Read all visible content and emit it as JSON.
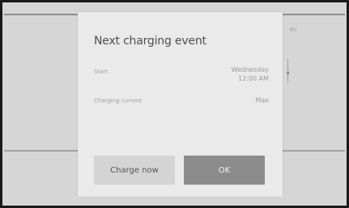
{
  "background": {
    "hint": "Fri"
  },
  "dialog": {
    "title": "Next charging event",
    "rows": [
      {
        "label": "Start",
        "value_line1": "Wednesday",
        "value_line2": "12:00 AM"
      },
      {
        "label": "Charging current",
        "value_line1": "Max"
      }
    ],
    "buttons": {
      "charge_now": "Charge now",
      "ok": "OK"
    }
  },
  "colors": {
    "dialog_bg": "#eaeaea",
    "screen_bg": "#d6d6d6",
    "ok_button": "#8c8c8c",
    "charge_button": "#d4d4d4",
    "frame": "#1a1a1a"
  }
}
